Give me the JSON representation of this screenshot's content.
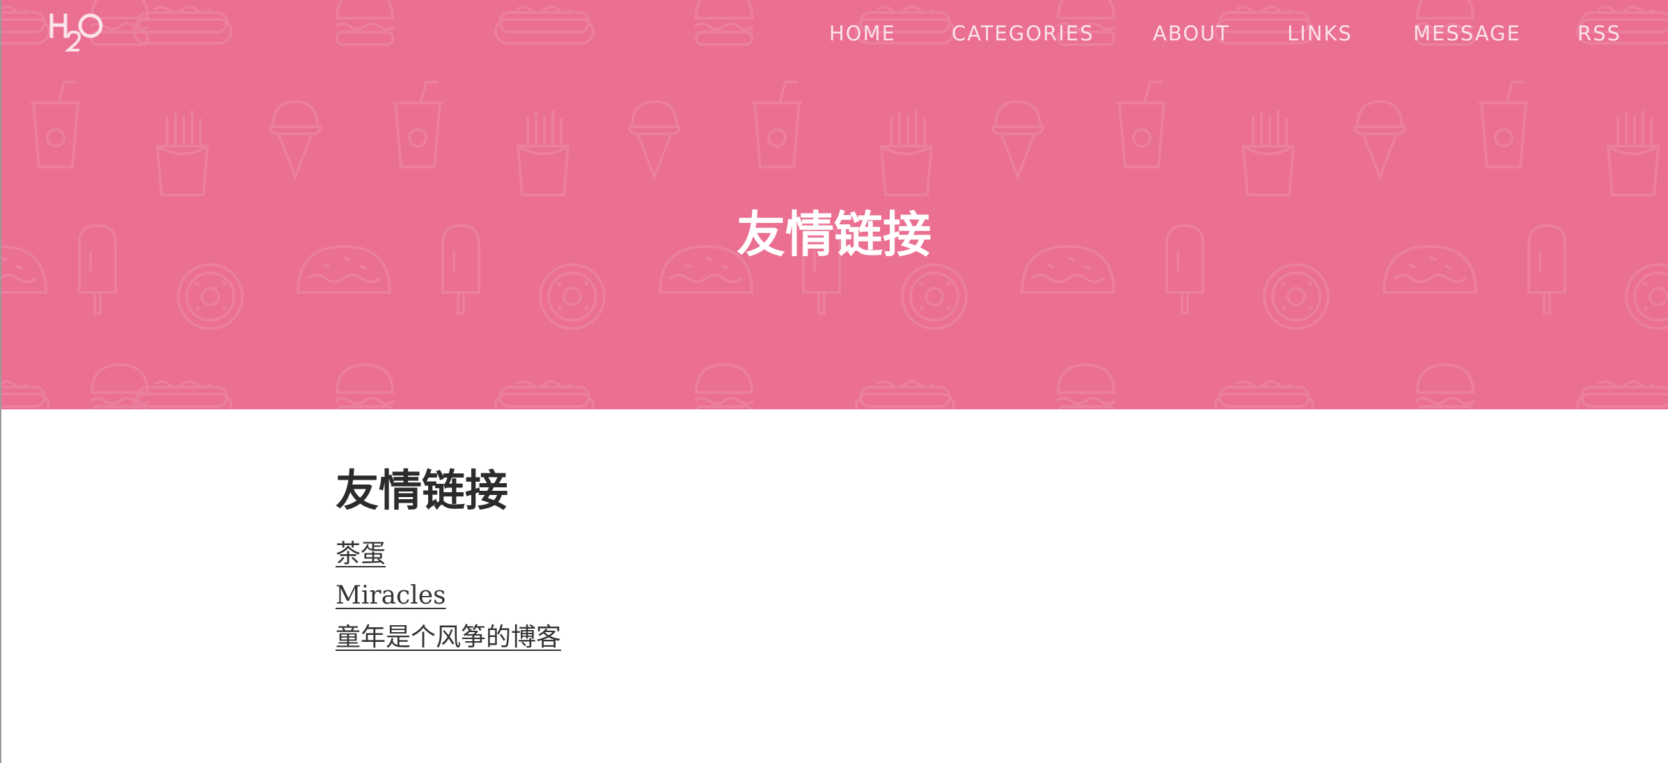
{
  "brand": {
    "logo_text": "H2O"
  },
  "nav": {
    "items": [
      {
        "label": "HOME"
      },
      {
        "label": "CATEGORIES"
      },
      {
        "label": "ABOUT"
      },
      {
        "label": "LINKS"
      },
      {
        "label": "MESSAGE"
      },
      {
        "label": "RSS"
      }
    ]
  },
  "hero": {
    "title": "友情链接",
    "background_color": "#ea6f91",
    "pattern_icons": [
      "hotdog-icon",
      "burger-icon",
      "soda-cup-icon",
      "fries-icon",
      "ice-cream-cone-icon",
      "popsicle-icon",
      "taco-icon",
      "donut-icon"
    ]
  },
  "content": {
    "title": "友情链接",
    "links": [
      {
        "label": "茶蛋"
      },
      {
        "label": "Miracles"
      },
      {
        "label": "童年是个风筝的博客"
      }
    ]
  },
  "colors": {
    "hero_bg": "#ea6f91",
    "nav_text": "#fbe3ea",
    "body_text": "#2b2b2b"
  }
}
